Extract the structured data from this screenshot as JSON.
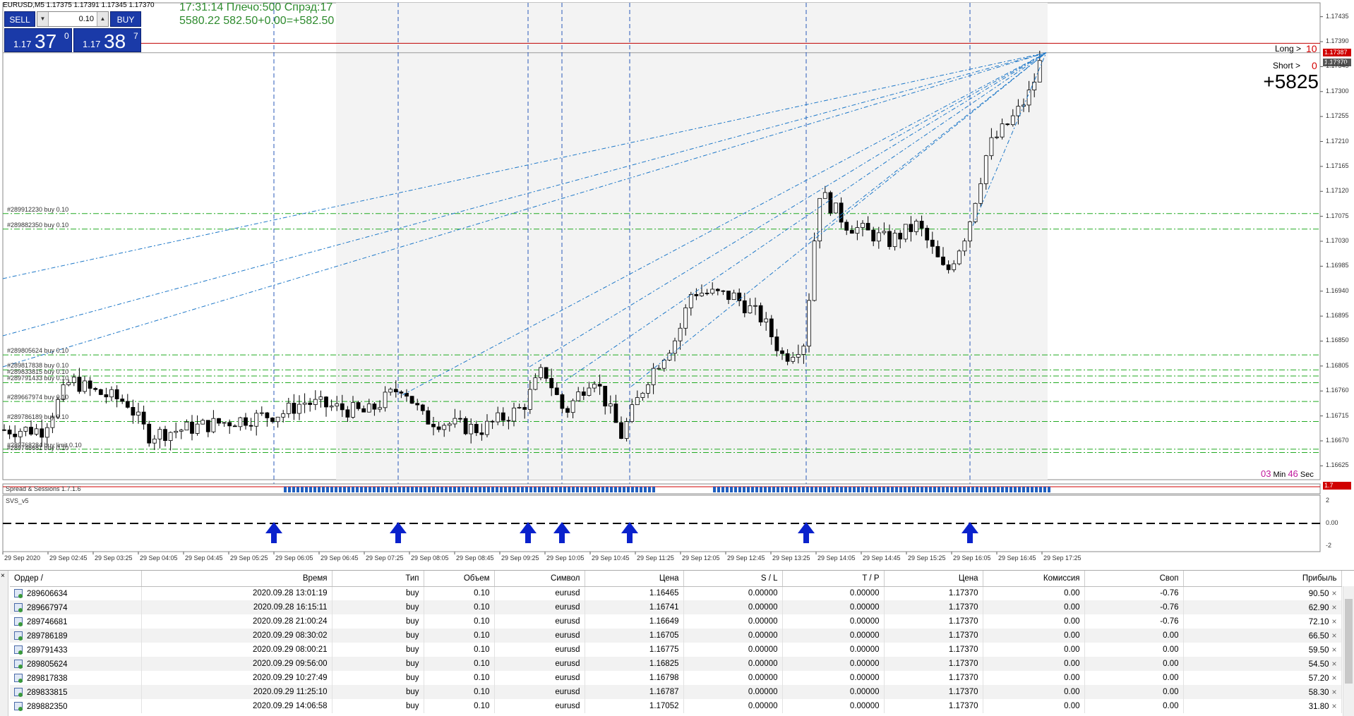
{
  "header": {
    "symbol_line": "EURUSD,M5  1.17375 1.17391 1.17345 1.17370",
    "info_line1": "17:31:14 Плечо:500 Спрэд:17",
    "info_line2": "5580.22   582.50+0.00=+582.50"
  },
  "trade_panel": {
    "sell_label": "SELL",
    "buy_label": "BUY",
    "lot_value": "0.10",
    "sell_price": {
      "prefix": "1.17",
      "big": "37",
      "sup": "0"
    },
    "buy_price": {
      "prefix": "1.17",
      "big": "38",
      "sup": "7"
    }
  },
  "right_info": {
    "long_label": "Long >",
    "long_value": "10",
    "short_label": "Short >",
    "short_value": "0",
    "profit_big": "+5825"
  },
  "timer": {
    "min_value": "03",
    "min_label": "Min",
    "sec_value": "46",
    "sec_label": "Sec"
  },
  "price_tags": {
    "ask": "1.17387",
    "bid": "1.17370",
    "spread": "1.7"
  },
  "indicators": {
    "spread_sessions": "Spread & Sessions 1.7.1.6",
    "svs": "SVS_v5"
  },
  "colors": {
    "panel_blue": "#1a3aa8",
    "bid_line": "#c00000",
    "order_line": "#22aa22",
    "arrow_blue": "#0a22cc",
    "link_line": "#1e78c8"
  },
  "chart_data": {
    "type": "candlestick",
    "symbol": "EURUSD",
    "timeframe": "M5",
    "y_ticks": [
      "1.17435",
      "1.17390",
      "1.17345",
      "1.17300",
      "1.17255",
      "1.17210",
      "1.17165",
      "1.17120",
      "1.17075",
      "1.17030",
      "1.16985",
      "1.16940",
      "1.16895",
      "1.16850",
      "1.16805",
      "1.16760",
      "1.16715",
      "1.16670",
      "1.16625"
    ],
    "x_ticks": [
      "29 Sep 2020",
      "29 Sep 02:45",
      "29 Sep 03:25",
      "29 Sep 04:05",
      "29 Sep 04:45",
      "29 Sep 05:25",
      "29 Sep 06:05",
      "29 Sep 06:45",
      "29 Sep 07:25",
      "29 Sep 08:05",
      "29 Sep 08:45",
      "29 Sep 09:25",
      "29 Sep 10:05",
      "29 Sep 10:45",
      "29 Sep 11:25",
      "29 Sep 12:05",
      "29 Sep 12:45",
      "29 Sep 13:25",
      "29 Sep 14:05",
      "29 Sep 14:45",
      "29 Sep 15:25",
      "29 Sep 16:05",
      "29 Sep 16:45",
      "29 Sep 17:25"
    ],
    "ylim": [
      1.166,
      1.1746
    ],
    "order_levels": [
      {
        "label": "#289912230 buy 0.10",
        "price": 1.1708
      },
      {
        "label": "#289882350 buy 0.10",
        "price": 1.17052
      },
      {
        "label": "#289805624 buy 0.10",
        "price": 1.16825
      },
      {
        "label": "#289817838 buy 0.10",
        "price": 1.16798
      },
      {
        "label": "#289833815 buy 0.10",
        "price": 1.16787
      },
      {
        "label": "#289791433 buy 0.10",
        "price": 1.16775
      },
      {
        "label": "#289667974 buy 0.10",
        "price": 1.16741
      },
      {
        "label": "#289786189 buy 0.10",
        "price": 1.16705
      },
      {
        "label": "#289746681 buy 0.10",
        "price": 1.16649
      },
      {
        "label": "#289768284 buy limit 0.10",
        "price": 1.16655
      }
    ],
    "bid": 1.1737,
    "ask": 1.17387
  },
  "orders_table": {
    "headers": [
      "Ордер",
      "Время",
      "Тип",
      "Объем",
      "Символ",
      "Цена",
      "S / L",
      "T / P",
      "Цена",
      "Комиссия",
      "Своп",
      "Прибыль"
    ],
    "sort_mark": "/",
    "rows": [
      [
        "289606634",
        "2020.09.28 13:01:19",
        "buy",
        "0.10",
        "eurusd",
        "1.16465",
        "0.00000",
        "0.00000",
        "1.17370",
        "0.00",
        "-0.76",
        "90.50"
      ],
      [
        "289667974",
        "2020.09.28 16:15:11",
        "buy",
        "0.10",
        "eurusd",
        "1.16741",
        "0.00000",
        "0.00000",
        "1.17370",
        "0.00",
        "-0.76",
        "62.90"
      ],
      [
        "289746681",
        "2020.09.28 21:00:24",
        "buy",
        "0.10",
        "eurusd",
        "1.16649",
        "0.00000",
        "0.00000",
        "1.17370",
        "0.00",
        "-0.76",
        "72.10"
      ],
      [
        "289786189",
        "2020.09.29 08:30:02",
        "buy",
        "0.10",
        "eurusd",
        "1.16705",
        "0.00000",
        "0.00000",
        "1.17370",
        "0.00",
        "0.00",
        "66.50"
      ],
      [
        "289791433",
        "2020.09.29 08:00:21",
        "buy",
        "0.10",
        "eurusd",
        "1.16775",
        "0.00000",
        "0.00000",
        "1.17370",
        "0.00",
        "0.00",
        "59.50"
      ],
      [
        "289805624",
        "2020.09.29 09:56:00",
        "buy",
        "0.10",
        "eurusd",
        "1.16825",
        "0.00000",
        "0.00000",
        "1.17370",
        "0.00",
        "0.00",
        "54.50"
      ],
      [
        "289817838",
        "2020.09.29 10:27:49",
        "buy",
        "0.10",
        "eurusd",
        "1.16798",
        "0.00000",
        "0.00000",
        "1.17370",
        "0.00",
        "0.00",
        "57.20"
      ],
      [
        "289833815",
        "2020.09.29 11:25:10",
        "buy",
        "0.10",
        "eurusd",
        "1.16787",
        "0.00000",
        "0.00000",
        "1.17370",
        "0.00",
        "0.00",
        "58.30"
      ],
      [
        "289882350",
        "2020.09.29 14:06:58",
        "buy",
        "0.10",
        "eurusd",
        "1.17052",
        "0.00000",
        "0.00000",
        "1.17370",
        "0.00",
        "0.00",
        "31.80"
      ]
    ]
  }
}
